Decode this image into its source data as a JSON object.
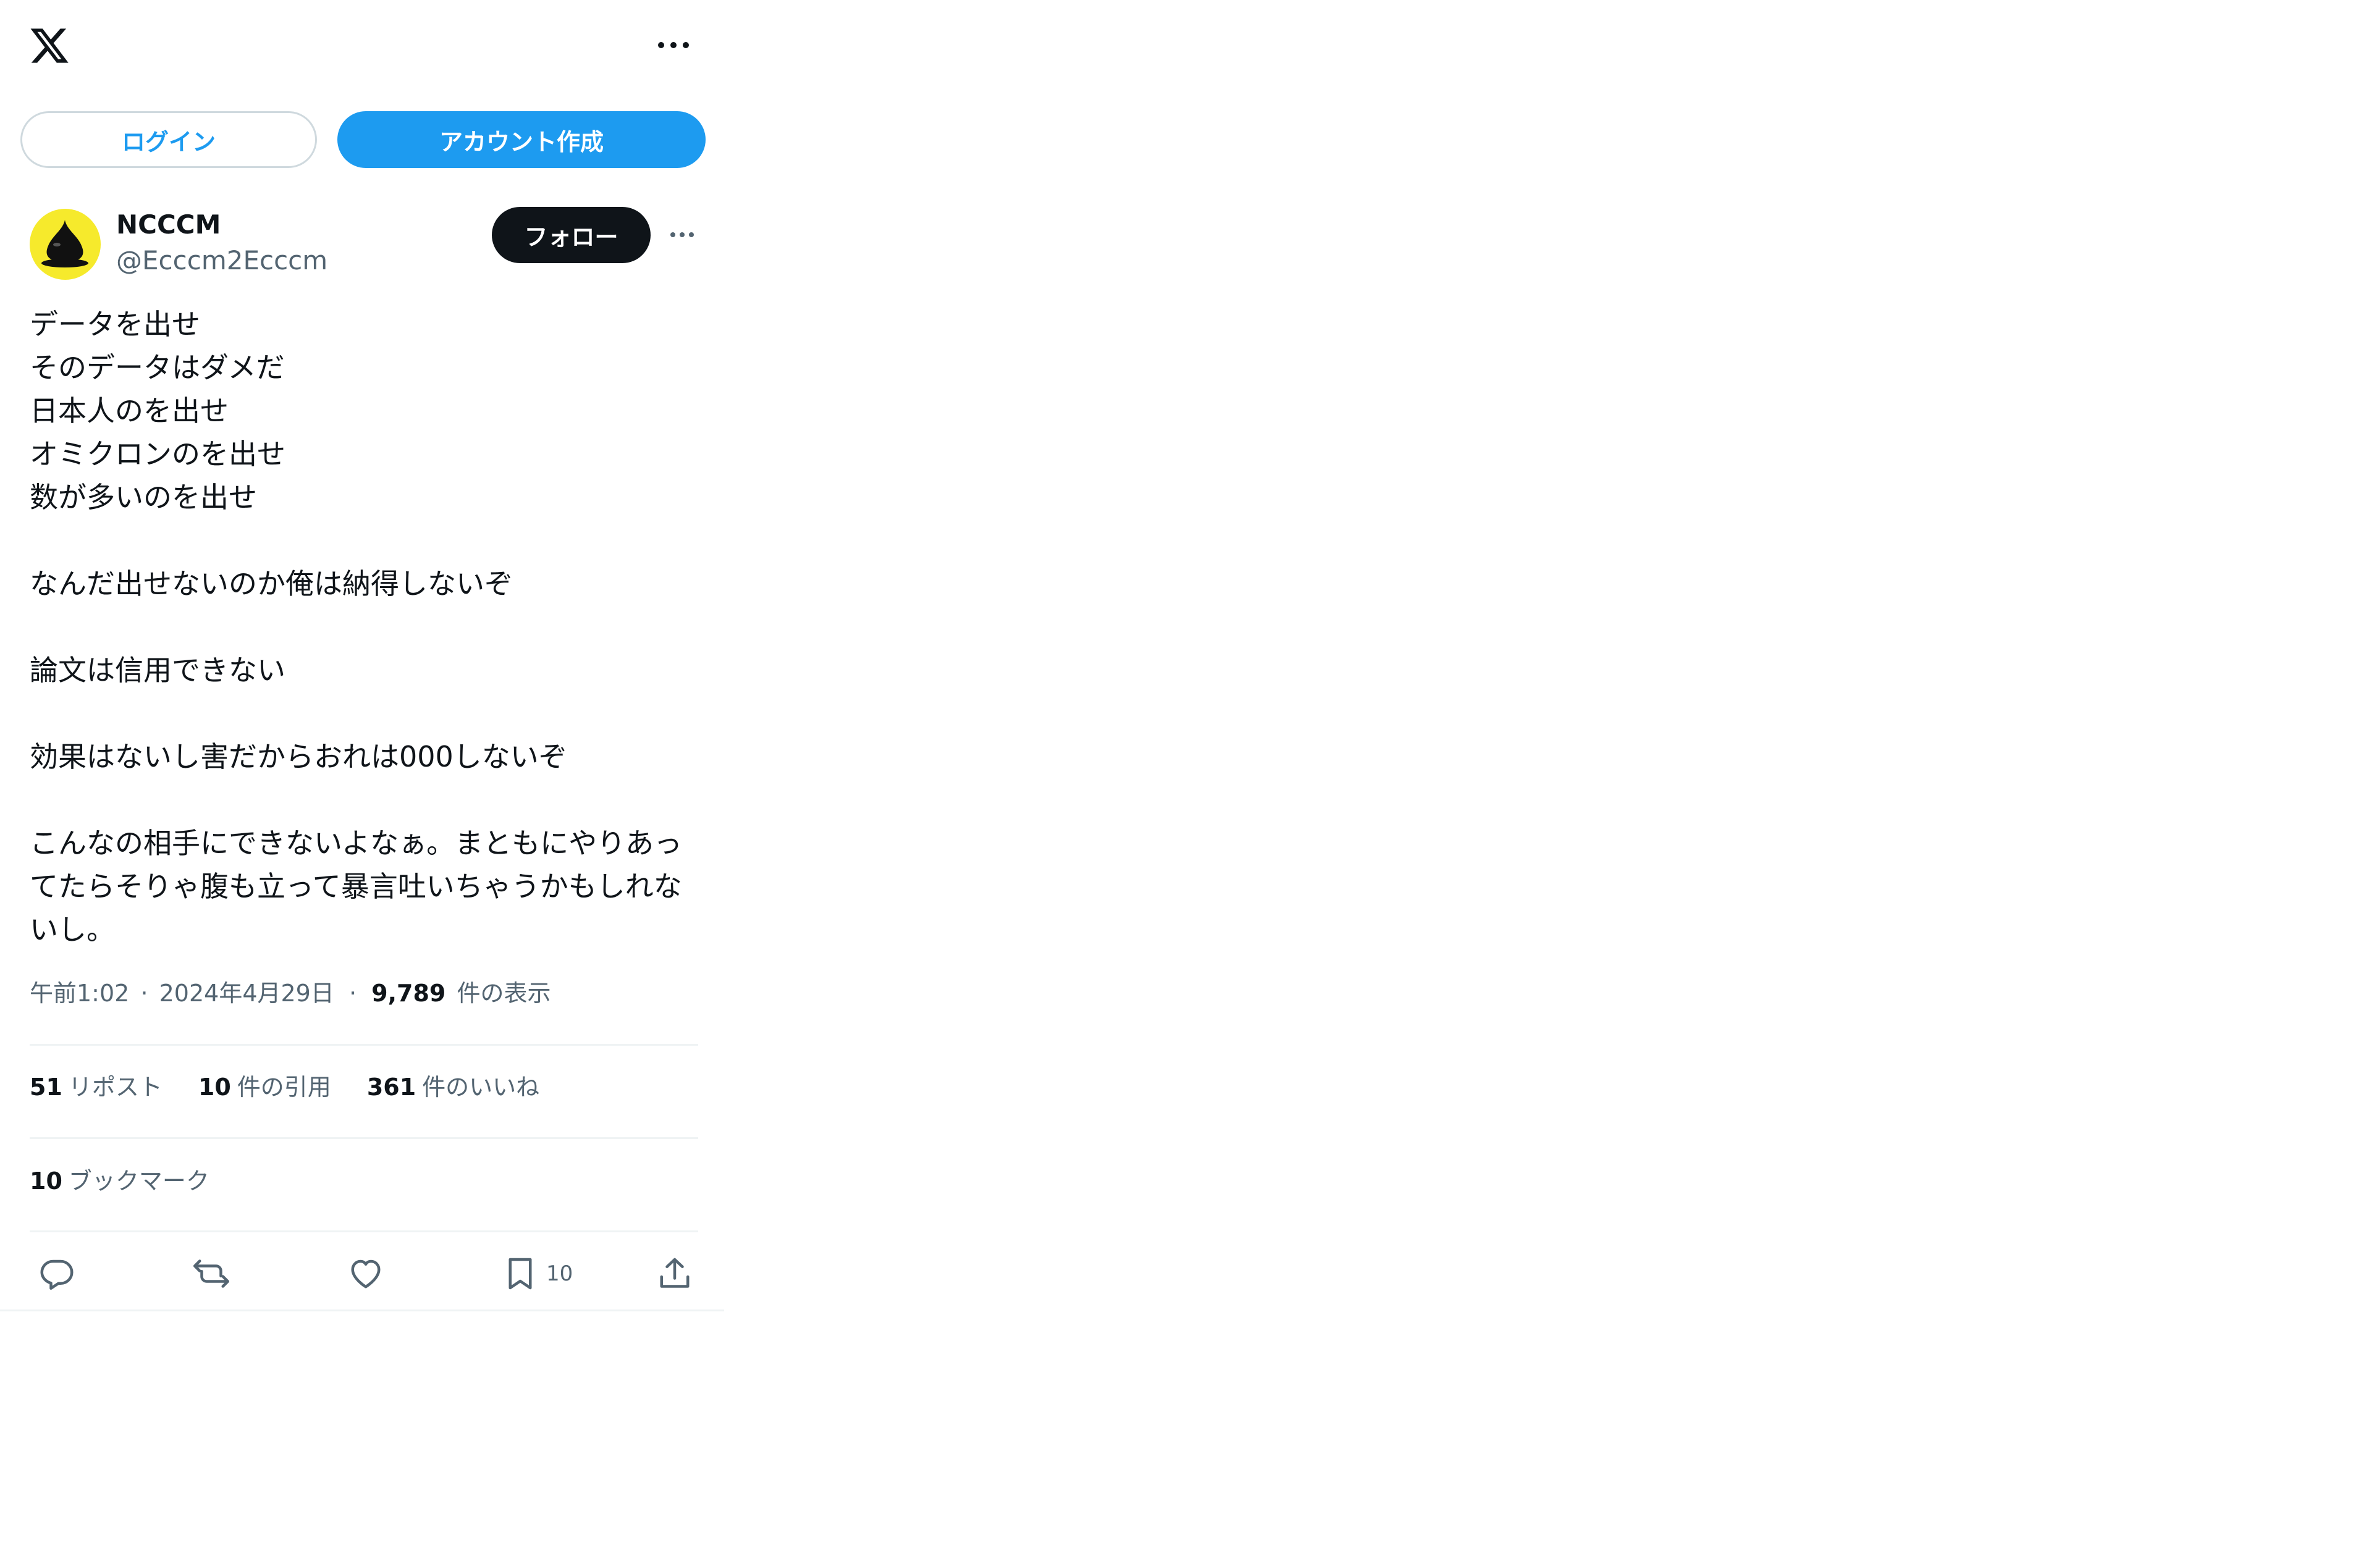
{
  "header": {
    "logo_icon": "x-logo-icon",
    "more_icon": "more-horizontal-icon"
  },
  "auth": {
    "login_label": "ログイン",
    "signup_label": "アカウント作成"
  },
  "author": {
    "display_name": "NCCCM",
    "handle": "@Ecccm2Ecccm",
    "follow_label": "フォロー"
  },
  "tweet": {
    "text": "データを出せ\nそのデータはダメだ\n日本人のを出せ\nオミクロンのを出せ\n数が多いのを出せ\n\nなんだ出せないのか俺は納得しないぞ\n\n論文は信用できない\n\n効果はないし害だからおれは000しないぞ\n\nこんなの相手にできないよなぁ。まともにやりあってたらそりゃ腹も立って暴言吐いちゃうかもしれないし。",
    "time": "午前1:02",
    "separator": "·",
    "date": "2024年4月29日",
    "views_count": "9,789",
    "views_label": "件の表示"
  },
  "stats": {
    "reposts_count": "51",
    "reposts_label": "リポスト",
    "quotes_count": "10",
    "quotes_label": "件の引用",
    "likes_count": "361",
    "likes_label": "件のいいね",
    "bookmarks_count": "10",
    "bookmarks_label": "ブックマーク"
  },
  "actions": {
    "reply_icon": "reply-icon",
    "repost_icon": "repost-icon",
    "like_icon": "heart-icon",
    "bookmark_icon": "bookmark-icon",
    "bookmark_count": "10",
    "share_icon": "share-icon"
  },
  "colors": {
    "accent": "#1d9bf0",
    "text": "#0f1419",
    "secondary": "#536471",
    "border": "#cfd9de",
    "divider": "#eff3f4"
  }
}
